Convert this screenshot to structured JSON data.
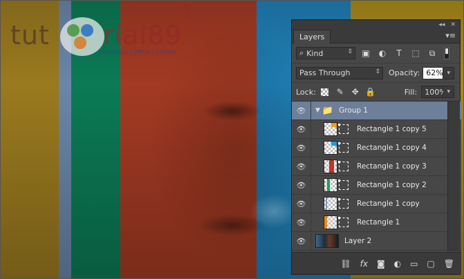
{
  "colors": {
    "stripe_mustard": "#9a7a1f",
    "stripe_steel": "#6a86a8",
    "stripe_green": "#0b7a55",
    "stripe_red": "#a33a23",
    "stripe_blue": "#1f7fb5",
    "stripe_gold": "#a98a1b",
    "selection": "#6d7f99"
  },
  "watermark": {
    "text_left": "tut",
    "text_right": "rial89",
    "com": ".COM",
    "tagline": "Photoshop | Office | Internet"
  },
  "panel": {
    "collapse_glyph": "◂◂",
    "close_glyph": "✕",
    "tab_label": "Layers",
    "menu_icon": "menu-icon",
    "filter_kind": "Kind",
    "blend_mode": "Pass Through",
    "opacity_label": "Opacity:",
    "opacity_value": "62%",
    "lock_label": "Lock:",
    "fill_label": "Fill:",
    "fill_value": "100%"
  },
  "layers": [
    {
      "name": "Group 1",
      "kind": "group",
      "selected": true
    },
    {
      "name": "Rectangle 1 copy 5",
      "kind": "shape",
      "color": "#f29a1a",
      "pos": "right-top"
    },
    {
      "name": "Rectangle 1 copy 4",
      "kind": "shape",
      "color": "#1a9be6",
      "pos": "right-top"
    },
    {
      "name": "Rectangle 1 copy 3",
      "kind": "shape",
      "color": "#c0322a",
      "pos": "center"
    },
    {
      "name": "Rectangle 1 copy 2",
      "kind": "shape",
      "color": "#1aa35a",
      "pos": "left"
    },
    {
      "name": "Rectangle 1 copy",
      "kind": "shape",
      "color": "#7f98bb",
      "pos": "left"
    },
    {
      "name": "Rectangle 1",
      "kind": "shape",
      "color": "#e08c1a",
      "pos": "left"
    },
    {
      "name": "Layer 2",
      "kind": "photo"
    }
  ],
  "footer_icons": [
    "link-icon",
    "fx-icon",
    "mask-icon",
    "adjustment-icon",
    "folder-icon",
    "new-layer-icon",
    "trash-icon"
  ]
}
